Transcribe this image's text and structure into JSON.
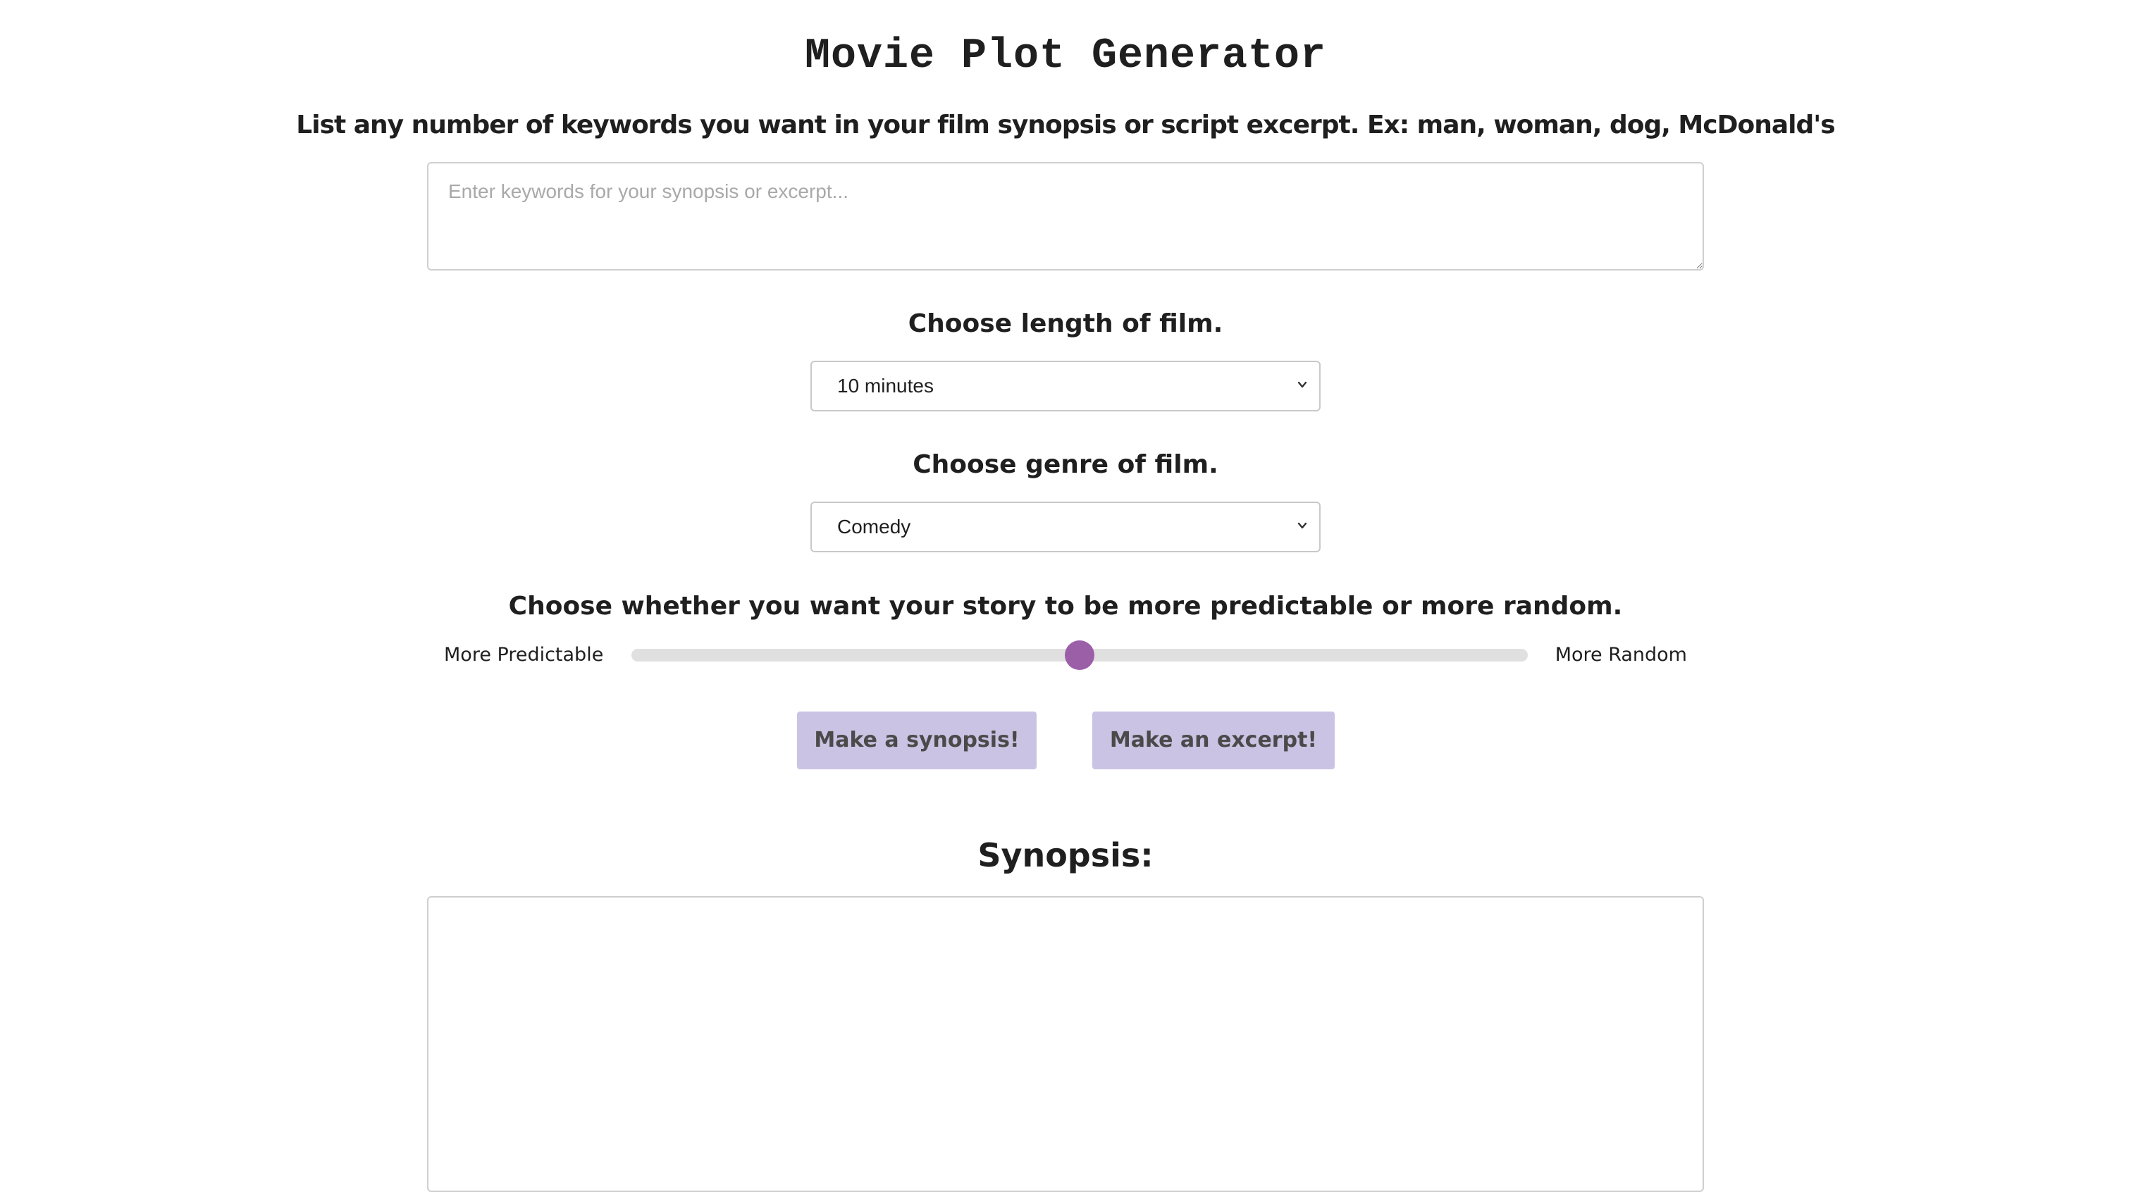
{
  "page": {
    "title": "Movie Plot Generator"
  },
  "keywords": {
    "label": "List any number of keywords you want in your film synopsis or script excerpt. Ex: man, woman, dog, McDonald's",
    "placeholder": "Enter keywords for your synopsis or excerpt...",
    "value": ""
  },
  "length": {
    "label": "Choose length of film.",
    "selected": "10 minutes",
    "icon": "chevron-down-icon"
  },
  "genre": {
    "label": "Choose genre of film.",
    "selected": "Comedy",
    "icon": "chevron-down-icon"
  },
  "randomness": {
    "label": "Choose whether you want your story to be more predictable or more random.",
    "left_label": "More Predictable",
    "right_label": "More Random",
    "value": 0.5,
    "thumb_color": "#9b5fa8",
    "track_color": "#e0e0e0"
  },
  "buttons": {
    "synopsis_label": "Make a synopsis!",
    "excerpt_label": "Make an excerpt!",
    "color": "#cbc3e3"
  },
  "output": {
    "heading": "Synopsis:",
    "content": ""
  }
}
